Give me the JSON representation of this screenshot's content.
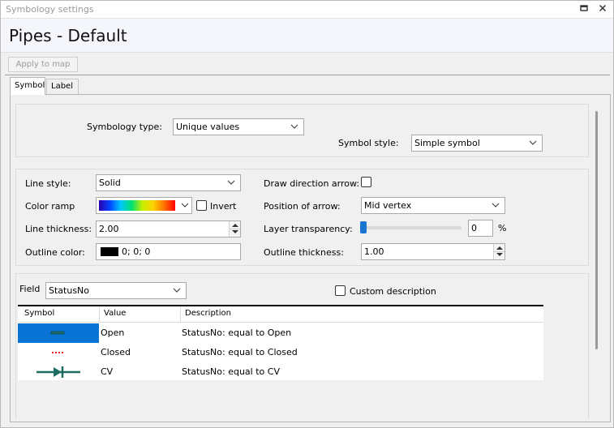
{
  "window": {
    "title": "Symbology settings",
    "restore_glyph": "▫",
    "close_glyph": "✕"
  },
  "header": {
    "title": "Pipes - Default"
  },
  "toolbar": {
    "apply_label": "Apply to map"
  },
  "tabs": [
    {
      "label": "Symbol",
      "active": true
    },
    {
      "label": "Label",
      "active": false
    }
  ],
  "symbology": {
    "type_label": "Symbology type:",
    "type_value": "Unique values",
    "style_label": "Symbol style:",
    "style_value": "Simple symbol"
  },
  "line": {
    "line_style_label": "Line style:",
    "line_style_value": "Solid",
    "color_ramp_label": "Color ramp",
    "invert_label": "Invert",
    "invert_checked": false,
    "thickness_label": "Line thickness:",
    "thickness_value": "2.00",
    "outline_color_label": "Outline color:",
    "outline_color_value": "0; 0; 0",
    "outline_color_hex": "#000000",
    "arrow_label": "Draw direction arrow:",
    "arrow_checked": false,
    "position_label": "Position of arrow:",
    "position_value": "Mid vertex",
    "transparency_label": "Layer transparency:",
    "transparency_value": "0",
    "transparency_unit": "%",
    "transparency_level": 0,
    "outline_thickness_label": "Outline thickness:",
    "outline_thickness_value": "1.00"
  },
  "field": {
    "label": "Field",
    "value": "StatusNo",
    "custom_desc_label": "Custom description",
    "custom_desc_checked": false
  },
  "table": {
    "headers": [
      "Symbol",
      "Value",
      "Description"
    ],
    "rows": [
      {
        "symbol": "solid-line-icon",
        "value": "Open",
        "description": "StatusNo: equal to Open",
        "selected": true
      },
      {
        "symbol": "dashed-red-line-icon",
        "value": "Closed",
        "description": "StatusNo: equal to Closed",
        "selected": false
      },
      {
        "symbol": "check-valve-icon",
        "value": "CV",
        "description": "StatusNo: equal to CV",
        "selected": false
      }
    ]
  },
  "colors": {
    "accent": "#0a74d6",
    "line_teal": "#1e6b62",
    "closed_red": "#e02020"
  }
}
